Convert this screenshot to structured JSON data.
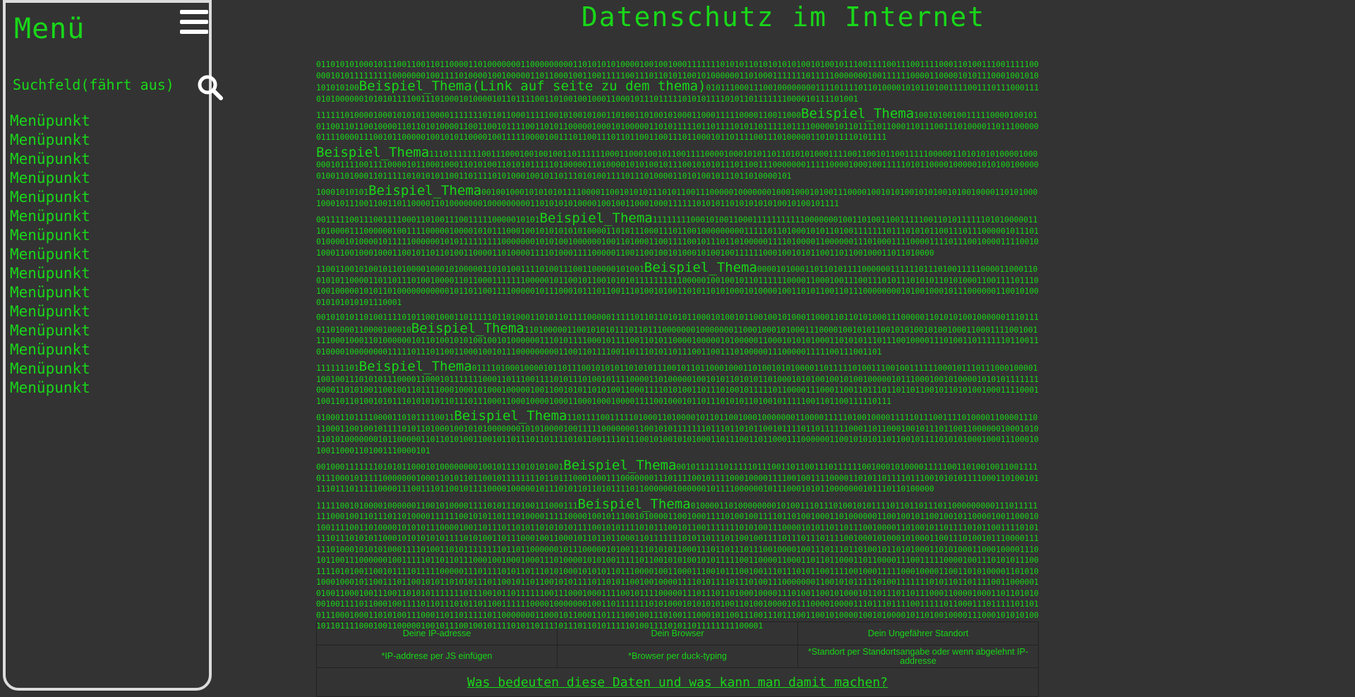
{
  "sidebar": {
    "title": "Menü",
    "menu_icon": "hamburger-icon",
    "search_label": "Suchfeld(fährt aus)",
    "search_icon": "search-icon",
    "items": [
      "Menüpunkt",
      "Menüpunkt",
      "Menüpunkt",
      "Menüpunkt",
      "Menüpunkt",
      "Menüpunkt",
      "Menüpunkt",
      "Menüpunkt",
      "Menüpunkt",
      "Menüpunkt",
      "Menüpunkt",
      "Menüpunkt",
      "Menüpunkt",
      "Menüpunkt",
      "Menüpunkt"
    ]
  },
  "header": {
    "title": "Datenschutz im Internet"
  },
  "binary_blocks": [
    {
      "pre": "0110101010001011100110011011000011010000000110000000001101010101000010010010001111111010101101010101010010100101110011110011100111100011010011100111110000010101111111110000000100111101000010010000011011000100110011111001110110101100101000000110100011111110111110000000100111111000011000010101110001001010101010100",
      "link": "Beispiel_Thema(Link auf seite zu dem thema)",
      "post": "0101110001110010000000011110111101101000010101101001111001110111000111010100000010101011110011101000101000010110111100110100100100011000101110111110101011110101101111111000010111101001"
    },
    {
      "pre": "111111010000100010101011000011111110110110001111100101001010011010011010010100011000111110000110011000",
      "link": "Beispiel_Thema",
      "post": "1001010010011111000010010101100110110010000110110101000011001100101111001101011000001000101000001101011111011011110101101111101111000001011011110110001101110011101000011011100000011110000111001011000001001010110000100111110000100111011001110110110011001110110001011011110011101000001101011110101111"
    },
    {
      "pre": "",
      "link": "Beispiel_Thema",
      "post": "11101111111001110001001001001101111110001100010010110011110000100010101101101010100011110011001011001111100000110101010100001000000101111001111000010110001000110101001101010111110100000110100001010100101110010101011101100111000000011111000010001001111101011000010000010101001000000100110100011011111010101011001101111010100010010110111010100111101110100001101010010111011010000101"
    },
    {
      "pre": "10001010101",
      "link": "Beispiel_Thema",
      "post": "00100100010101010111100001100101010111010110011100000100000001000100010100111000010010101001010100101001000011010100010001011100110011011000011010000000100000000011010101010000100100110001000111111010101101010101010010100101111"
    },
    {
      "pre": "00111110011100111100011010011100111110000010101",
      "link": "Beispiel_Thema",
      "post": "11111111000101001100011111111111000000010011010011001111100110101111110101000001110100001110000001001111000001000010101110001001010101010100001101011100011101100100000000011111011010001010110100111111101110101011001110111000001011101010000101000010111110000001010111111111000000010101001000000100110100011001111001011101101000001111010000110000001110100011110000111101110010000111100101000110010001000110010110110100110000110100001111010001111000001100110010010100010100100111111000100101011001101100100011011010000"
    },
    {
      "pre": "110011001010010110100001000101000001101010011110100111001100000101001",
      "link": "Beispiel_Thema",
      "post": "000010100011011010111100000011111101110100111110000110001100101011000011011011101001000011011000111111100000101100101100101010111111111100000100100101101111110000110001001110011101011101010110101000110011110111010010000010101101000000000001011011001111000001011100010111011001110100101001101011010100010100001001101011001101110000000010100100010111000000110010100010101010101110001"
    },
    {
      "pre": "0010101011010011110101100100011011111011010001101011011110000011111011011010101100010100101100100101000110001101101010001110000011010101001000000111011101101000110000100010",
      "link": "Beispiel_Thema",
      "post": "1101000001100101010111011011100000001000000011000100010100011100001001010110010101001010010001100011110010011110001000110100000010110100101010010010100000011101011110001011110011010110000100000101000001100010101010001101010111011100100001110100110111111011001101000010000000011111011101100110001001011100000000011001101111001101110101101110011001110100000111000001111100111001101"
    },
    {
      "pre": "111111101",
      "link": "Beispiel_Thema",
      "post": "0111101000100001011011100101010110101011100101101100010001101001010100001101111101001110010011111100010111011100010000110010011101010111000011000101111111000110111001111010111010010111100001101000001001010110101011010001010100100101001000001011100010010100001010101111111000011010100110010011011110001000101000100000100110010101101010011000111101010011011101001011111011000011100011001101110110110110010110101001000111100011001101101001010111010101011011101110001100010000100011000100010000111100100010110111010101101001011111001101100111110111"
    },
    {
      "pre": "01000110111100001101011110011",
      "link": "Beispiel_Thema",
      "post": "1101111001111101000110100001011011001000100000001100001111101001000011111011100111101000011000011101100011001001011110101101000100101010000000101010000100111110000000110010101111111011101101011001011110110111111000110110001001011101100110000001000101011010100000001011000001101101010011001011011101101111010110011110111001010010101000110111001101100011100000011001010101101100101111010101000100011100010100110001101001110000101"
    },
    {
      "pre": "0010001111111010101100010100000000100101111010101001",
      "link": "Beispiel_Thema",
      "post": "0010111111011111011100110110011101111110010001010000111110011010010011001111011100010111110000000100011010110110010111111110110111000100011100000001110111100101111000100001111001001111000011010110111101110010101011110001101001011110111011111000011100111011001011110000100000101110101101101011110110000001000000101111000000101110001010110000000101110110100000"
    },
    {
      "pre": "1111100101000010000001100101000011110101110100111000111",
      "link": "Beispiel_Thema",
      "post": "0100001101000000001010011101110100101011110110110111011000000000111011111111000100110111011010000111111001010110111010000111110000100101110010100001100100011110100100111101101001000110100000011001001011001001011000010011000101001111001101000010101011100001001101110110101101010101111001010111101011100101100111111101010011100001010110110111001000011010010110111101011001111010111101110101011000101010101011110101001101110001001100010110110110001101111111010110111011001001111011101110111100100010100010100011001110100101110000111111010001010101000111101001101011111111011011000000101110000010100111101010110001110110111011100100001001110111011010010110101000110101000110001000011101011001110000001001111101101101110001001000100011101000010101001111101100101010010101111100110000110001101101100011011000011100111110000100111010101110011110101001100101111011111000001110111101011011101010001010101101110000100110001110010111001001110111010110011110010001111100010000110011010100001101010100010001011001110110010101101010111011001011011001010111101101011001001000011110101111011101001110000000110010101111101001111111010110110111100110000010100110001001110011010101111111011100101101111110011100010001111001011110000011101110110100010000111010011001010001011011101101110001100001000110110101000100111101100010011110110111010110110011111100001000000010011011111110101000101010101001101001000010111000010000111011101111001111101100011101111101101011100010001101010011100011011011111011000000011000101100011011110010011101001110001011001110011101110011001010000100101000010110100100001110001010101001011011110001001100000100101110010010111101011011110111011010111110100111101011011111111100001"
    }
  ],
  "table": {
    "headers": [
      "Deine IP-adresse",
      "Dein Browser",
      "Dein Ungefährer Standort"
    ],
    "values": [
      "*IP-addrese per JS einfügen",
      "*Browser per duck-typing",
      "*Standort per Standortsangabe oder wenn abgelehnt IP-addresse"
    ],
    "link": "Was bedeuten diese Daten und was kann man damit machen?"
  }
}
